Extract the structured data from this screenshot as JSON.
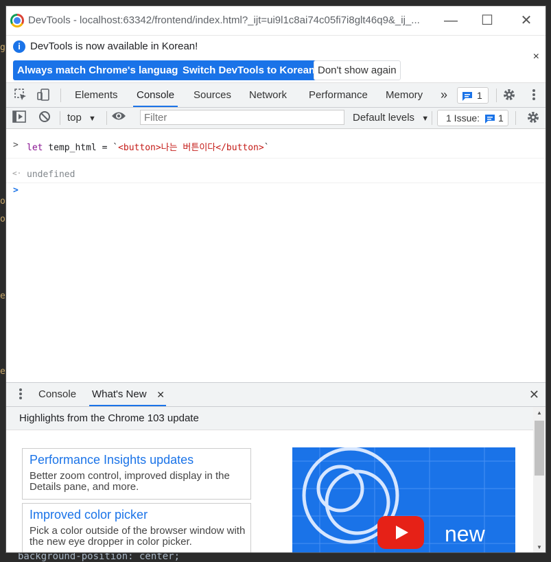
{
  "window": {
    "title": "DevTools - localhost:63342/frontend/index.html?_ijt=ui9l1c8ai74c05fi7i8glt46q9&_ij_...",
    "minimize_glyph": "—",
    "maximize_glyph": "☐",
    "close_glyph": "✕"
  },
  "infobar": {
    "message": "DevTools is now available in Korean!",
    "always_match_label": "Always match Chrome's language",
    "switch_label": "Switch DevTools to Korean",
    "dont_show_label": "Don't show again",
    "close_glyph": "×"
  },
  "tabs": {
    "items": [
      "Elements",
      "Console",
      "Sources",
      "Network",
      "Performance",
      "Memory"
    ],
    "active": "Console",
    "more_glyph": "»",
    "message_count": "1"
  },
  "console_toolbar": {
    "context": "top",
    "filter_placeholder": "Filter",
    "levels": "Default levels",
    "issues_label": "1 Issue:",
    "issues_count": "1"
  },
  "console": {
    "input_prompt": ">",
    "input_keyword": "let",
    "input_code": " temp_html = `",
    "input_string": "<button>나는 버튼이다</button>",
    "input_close": "`",
    "result_prompt": "<·",
    "result": "undefined",
    "cursor_prompt": ">"
  },
  "drawer": {
    "tabs": [
      "Console",
      "What's New"
    ],
    "active": "What's New",
    "header": "Highlights from the Chrome 103 update",
    "cards": [
      {
        "title": "Performance Insights updates",
        "description": "Better zoom control, improved display in the Details pane, and more."
      },
      {
        "title": "Improved color picker",
        "description": "Pick a color outside of the browser window with the new eye dropper in color picker."
      }
    ],
    "promo_text": "new"
  },
  "background": {
    "bottom_code": "background-position: center;"
  },
  "colors": {
    "accent": "#1a73e8",
    "keyword": "#881391",
    "string": "#c41a16"
  }
}
